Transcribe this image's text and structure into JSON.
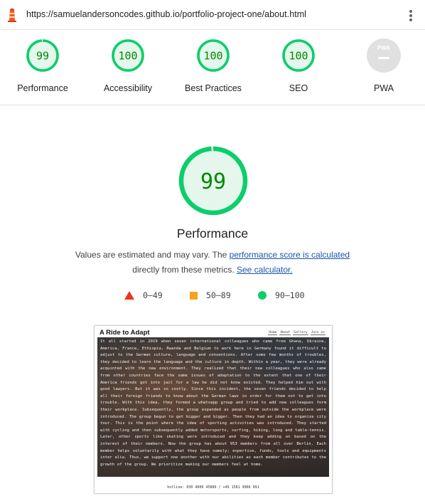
{
  "url_bar": {
    "url": "https://samuelandersoncodes.github.io/portfolio-project-one/about.html",
    "logo_icon": "lighthouse-icon",
    "menu_icon": "kebab-menu-icon"
  },
  "colors": {
    "pass_green": "#0cce6b",
    "pass_green_text": "#008800",
    "pass_green_fill": "#e5f7ec",
    "average_orange": "#f4a31f",
    "fail_red": "#eb3323",
    "pwa_gray": "#e0e0e0",
    "link_blue": "#1a55a8"
  },
  "scores": [
    {
      "label": "Performance",
      "value": "99",
      "fraction": 0.99
    },
    {
      "label": "Accessibility",
      "value": "100",
      "fraction": 1.0
    },
    {
      "label": "Best Practices",
      "value": "100",
      "fraction": 1.0
    },
    {
      "label": "SEO",
      "value": "100",
      "fraction": 1.0
    },
    {
      "label": "PWA",
      "badge_text": "PWA",
      "icon": "pwa-badge-icon"
    }
  ],
  "performance": {
    "score": "99",
    "fraction": 0.99,
    "title": "Performance",
    "desc_prefix": "Values are estimated and may vary. The ",
    "desc_link": "performance score is calculated",
    "desc_middle": "directly from these metrics. ",
    "desc_link2": "See calculator."
  },
  "legend": [
    {
      "icon": "fail-triangle-icon",
      "label": "0–49"
    },
    {
      "icon": "average-square-icon",
      "label": "50–89"
    },
    {
      "icon": "pass-circle-icon",
      "label": "90–100"
    }
  ],
  "screenshot": {
    "title": "A Ride to Adapt",
    "nav": [
      "Home",
      "About",
      "Gallery",
      "Join us"
    ],
    "body": "It all started in 2019 when seven international colleagues who came from Ghana, Ukraine, America, France, Ethiopia, Rwanda and Belgium to work here in Germany found it difficult to adjust to the German culture, language and conventions. After some few months of troubles, they decided to learn the language and the culture in depth. Within a year, they were already acquinted with the new environment. They realized that their new colleagues who also came from other countries face the same issues of adaptation to the extent that one of their America friends got into jail for a law he did not know existed. They helped him out with good lawyers. But it was so costly. Since this incident, the seven friends decided to help all their foreign friends to know about the German laws in order for them not to get into trouble. With this idea, they formed a whatsapp group and tried to add new colleagues form their workplace. Subsequently, the group expanded as people from outside the workplace were introduced. The group begun to get bigger and bigger. Then they had an idea to organize city tour. This is the point where the idea of sporting activities was introduced. They started with cycling and then subsequently added motorsports, surfing, hiking, long and table-tennis. Later, other sports like skating were introduced and they keep adding on based on the interest of their members. Now the group has about 953 members from all over Berlin. Each member helps voluntarily with what they have namely; expertise, funds, tools and equipments inter alia. Thus, we support one another with our abilities as each member contributes to the growth of the group. We prioritize making our members feel at home.",
    "footer": "hotline: 030 4600 45889 / +49 1581 9966 991"
  }
}
